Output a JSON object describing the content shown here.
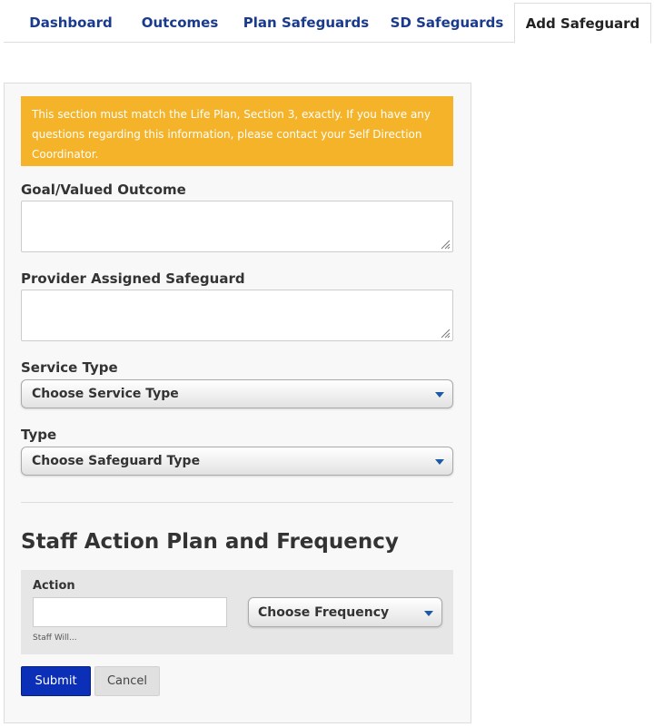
{
  "tabs": [
    {
      "label": "Dashboard"
    },
    {
      "label": "Outcomes"
    },
    {
      "label": "Plan Safeguards"
    },
    {
      "label": "SD Safeguards"
    },
    {
      "label": "Add Safeguard",
      "active": true
    }
  ],
  "form": {
    "notice": "This section must match the Life Plan, Section 3, exactly. If you have any questions regarding this information, please contact your Self Direction Coordinator.",
    "goal_label": "Goal/Valued Outcome",
    "goal_value": "",
    "provider_label": "Provider Assigned Safeguard",
    "provider_value": "",
    "service_type_label": "Service Type",
    "service_type_selected": "Choose Service Type",
    "type_label": "Type",
    "type_selected": "Choose Safeguard Type"
  },
  "action_plan": {
    "title": "Staff Action Plan and Frequency",
    "action_label": "Action",
    "action_value": "",
    "action_help": "Staff Will...",
    "frequency_selected": "Choose Frequency"
  },
  "buttons": {
    "submit_label": "Submit",
    "cancel_label": "Cancel"
  },
  "colors": {
    "notice_bg": "#f5b32a",
    "tab_link": "#1a3a8c",
    "submit_bg": "#0b2fb6",
    "caret": "#1a5aa8"
  }
}
